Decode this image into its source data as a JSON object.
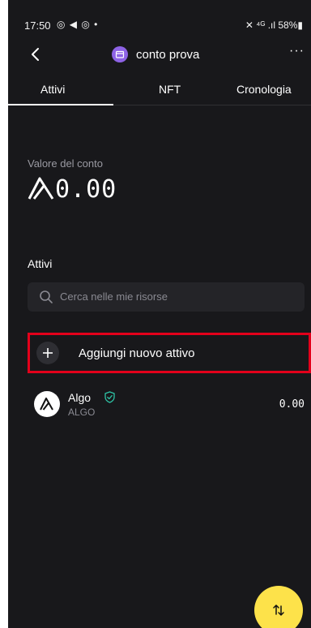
{
  "status_bar": {
    "time": "17:50",
    "left_icons": "◎ ◀ ◎ •",
    "right": "✕ ⁴ᴳ .ıl 58%▮"
  },
  "header": {
    "back_icon": "chevron-left-icon",
    "account_name": "conto prova",
    "account_icon": "wallet-icon",
    "account_icon_color": "#8e63e6",
    "more_label": "···"
  },
  "tabs": [
    {
      "label": "Attivi",
      "active": true
    },
    {
      "label": "NFT",
      "active": false
    },
    {
      "label": "Cronologia",
      "active": false
    }
  ],
  "balance": {
    "label": "Valore del conto",
    "value": "0.00",
    "currency_icon": "algo-icon"
  },
  "assets_section": {
    "title": "Attivi",
    "search_placeholder": "Cerca nelle mie risorse",
    "add_label": "Aggiungi nuovo attivo"
  },
  "assets": [
    {
      "name": "Algo",
      "ticker": "ALGO",
      "amount": "0.00",
      "verified": true,
      "icon": "algo-icon"
    }
  ],
  "colors": {
    "background": "#18181b",
    "accent_fab": "#fde24a",
    "highlight": "#e3001b",
    "verified": "#2ec4a6"
  },
  "fab": {
    "icon": "swap-arrows-icon"
  }
}
